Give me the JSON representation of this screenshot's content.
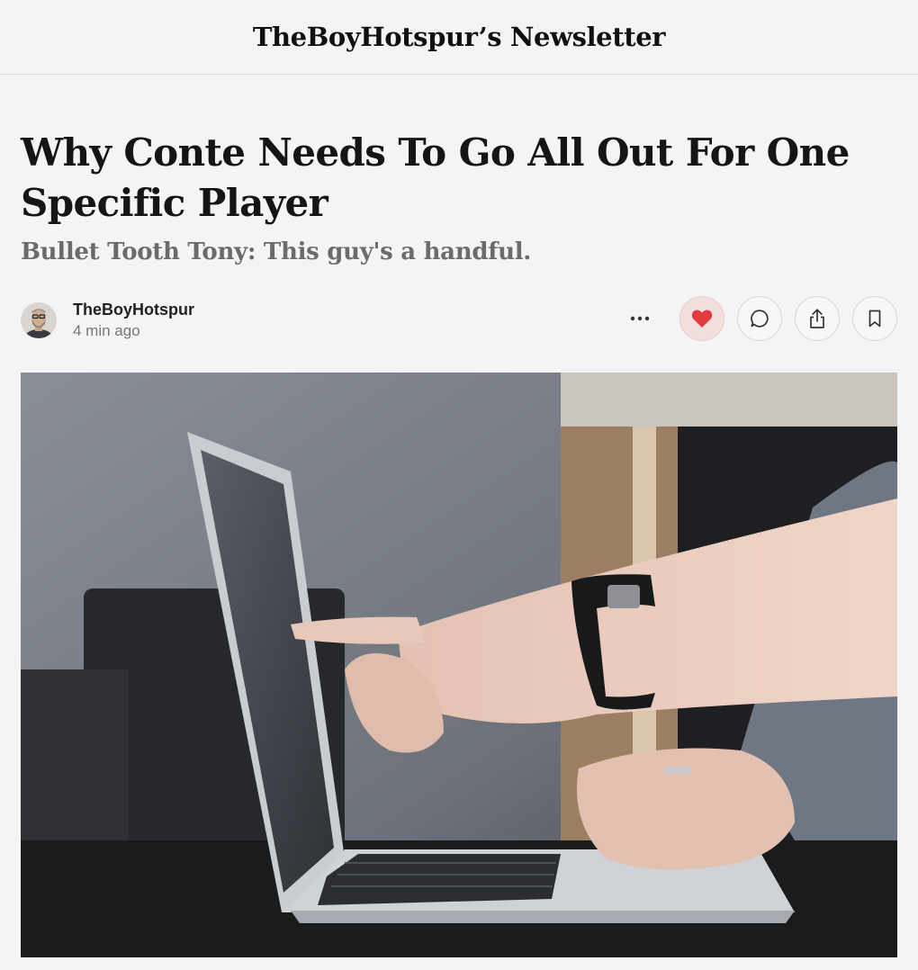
{
  "publication": {
    "title": "TheBoyHotspur’s Newsletter"
  },
  "post": {
    "title": "Why Conte Needs To Go All Out For One Specific Player",
    "subtitle": "Bullet Tooth Tony: This guy's a handful."
  },
  "author": {
    "name": "TheBoyHotspur",
    "time": "4 min ago"
  },
  "actions": {
    "more_icon": "more-horizontal-icon",
    "like_icon": "heart-icon",
    "like_color": "#e0393e",
    "comment_icon": "comment-icon",
    "share_icon": "share-icon",
    "bookmark_icon": "bookmark-icon"
  },
  "hero_image": {
    "description_icon": "laptop-photo"
  }
}
